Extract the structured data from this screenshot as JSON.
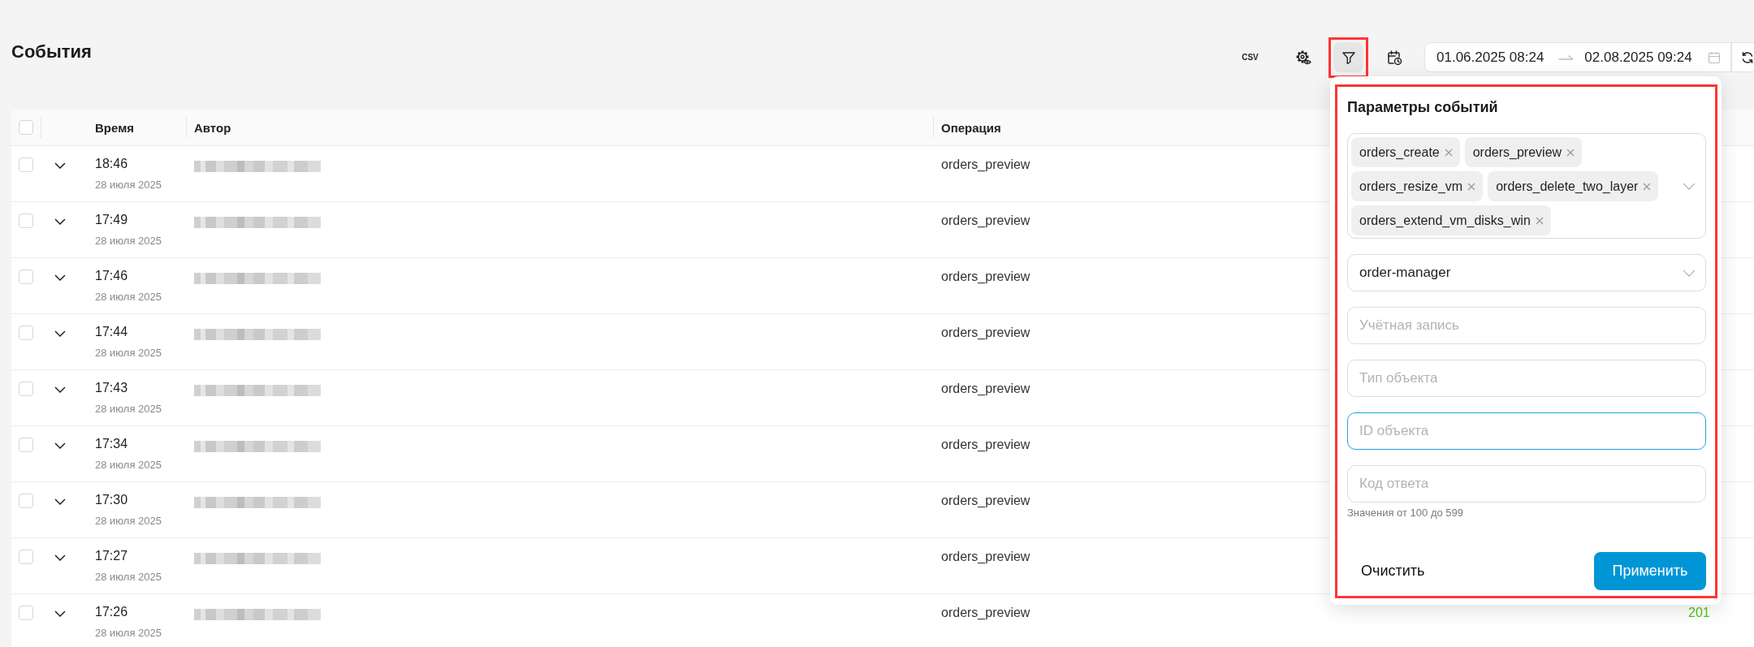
{
  "page": {
    "title": "События"
  },
  "toolbar": {
    "buttons": [
      {
        "kind": "csv",
        "label": "CSV",
        "active": false,
        "highlighted": false
      },
      {
        "kind": "column_settings",
        "active": false,
        "highlighted": false
      },
      {
        "kind": "filter",
        "active": true,
        "highlighted": true
      },
      {
        "kind": "schedule",
        "active": false,
        "highlighted": false
      }
    ],
    "date_range": {
      "from": "01.06.2025 08:24",
      "to": "02.08.2025 09:24"
    }
  },
  "table": {
    "select_all": {
      "checked": false
    },
    "columns": [
      {
        "label": "Время"
      },
      {
        "label": "Автор"
      },
      {
        "label": "Операция"
      }
    ],
    "rows": [
      {
        "checked": false,
        "expanded": false,
        "time": "18:46",
        "date": "28 июля 2025",
        "operation": "orders_preview"
      },
      {
        "checked": false,
        "expanded": false,
        "time": "17:49",
        "date": "28 июля 2025",
        "operation": "orders_preview"
      },
      {
        "checked": false,
        "expanded": false,
        "time": "17:46",
        "date": "28 июля 2025",
        "operation": "orders_preview"
      },
      {
        "checked": false,
        "expanded": false,
        "time": "17:44",
        "date": "28 июля 2025",
        "operation": "orders_preview"
      },
      {
        "checked": false,
        "expanded": false,
        "time": "17:43",
        "date": "28 июля 2025",
        "operation": "orders_preview"
      },
      {
        "checked": false,
        "expanded": false,
        "time": "17:34",
        "date": "28 июля 2025",
        "operation": "orders_preview"
      },
      {
        "checked": false,
        "expanded": false,
        "time": "17:30",
        "date": "28 июля 2025",
        "operation": "orders_preview"
      },
      {
        "checked": false,
        "expanded": false,
        "time": "17:27",
        "date": "28 июля 2025",
        "operation": "orders_preview"
      },
      {
        "checked": false,
        "expanded": false,
        "time": "17:26",
        "date": "28 июля 2025",
        "operation": "orders_preview",
        "column_6": "201"
      }
    ]
  },
  "filter_panel": {
    "title": "Параметры событий",
    "highlighted": true,
    "operations": {
      "tags": [
        "orders_create",
        "orders_preview",
        "orders_resize_vm",
        "orders_delete_two_layer",
        "orders_extend_vm_disks_win"
      ]
    },
    "service": {
      "value": "order-manager"
    },
    "fields": [
      {
        "placeholder": "Учётная запись",
        "focused": false
      },
      {
        "placeholder": "Тип объекта",
        "focused": false
      },
      {
        "placeholder": "ID объекта",
        "focused": true
      },
      {
        "placeholder": "Код ответа",
        "focused": false,
        "hint": "Значения от 100 до 599"
      }
    ],
    "actions": [
      {
        "kind": "secondary",
        "label": "Очистить"
      },
      {
        "kind": "primary",
        "label": "Применить"
      }
    ]
  }
}
